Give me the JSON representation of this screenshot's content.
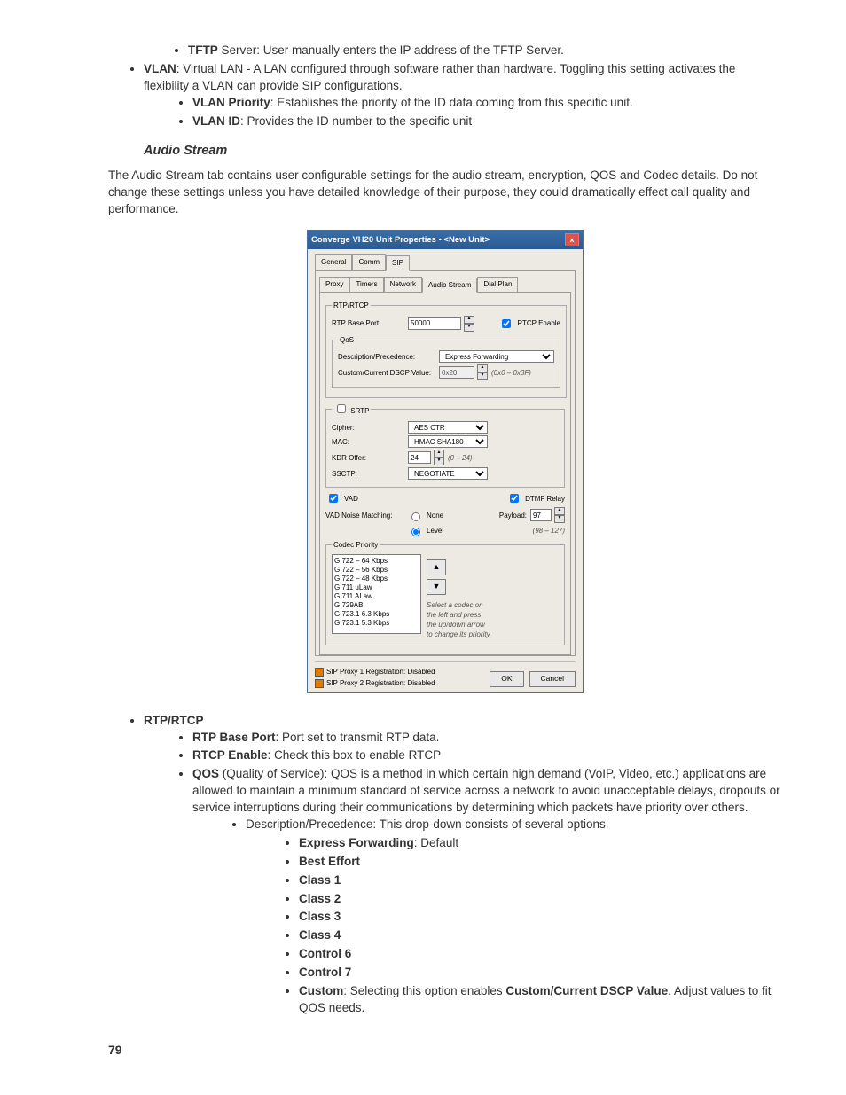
{
  "top_bullets": {
    "tftp": {
      "bold": "TFTP",
      "rest": " Server: User manually enters the IP address of the TFTP Server."
    },
    "vlan": {
      "bold": "VLAN",
      "rest": ": Virtual LAN - A LAN configured through software rather than hardware. Toggling this setting activates the flexibility a VLAN can provide SIP configurations."
    },
    "vlan_priority": {
      "bold": "VLAN Priority",
      "rest": ": Establishes the priority of the ID data coming from this specific unit."
    },
    "vlan_id": {
      "bold": "VLAN ID",
      "rest": ": Provides the ID number to the specific unit"
    }
  },
  "section_head": "Audio Stream",
  "intro_para": "The Audio Stream tab contains user configurable settings for the audio stream, encryption, QOS and Codec details. Do not change these settings unless you have detailed knowledge of their purpose, they could dramatically effect call quality and performance.",
  "dialog": {
    "title": "Converge VH20 Unit Properties - <New Unit>",
    "tabs_top": [
      "General",
      "Comm",
      "SIP"
    ],
    "tabs_top_sel": 2,
    "tabs_sub": [
      "Proxy",
      "Timers",
      "Network",
      "Audio Stream",
      "Dial Plan"
    ],
    "tabs_sub_sel": 3,
    "rtp": {
      "legend": "RTP/RTCP",
      "base_port_label": "RTP Base Port:",
      "base_port_value": "50000",
      "rtcp_enable_label": "RTCP Enable",
      "qos_legend": "QoS",
      "desc_label": "Description/Precedence:",
      "desc_value": "Express Forwarding",
      "dscp_label": "Custom/Current DSCP Value:",
      "dscp_value": "0x20",
      "dscp_hint": "(0x0 – 0x3F)"
    },
    "srtp": {
      "legend": "SRTP",
      "cipher_label": "Cipher:",
      "cipher_value": "AES CTR",
      "mac_label": "MAC:",
      "mac_value": "HMAC SHA180",
      "kdr_label": "KDR Offer:",
      "kdr_value": "24",
      "kdr_hint": "(0 – 24)",
      "ssctp_label": "SSCTP:",
      "ssctp_value": "NEGOTIATE"
    },
    "vad": {
      "vad_label": "VAD",
      "noise_label": "VAD Noise Matching:",
      "opt_none": "None",
      "opt_level": "Level",
      "dtmf_label": "DTMF Relay",
      "payload_label": "Payload:",
      "payload_value": "97",
      "payload_hint": "(98 – 127)"
    },
    "codec": {
      "legend": "Codec Priority",
      "items": [
        "G.722 – 64 Kbps",
        "G.722 – 56 Kbps",
        "G.722 – 48 Kbps",
        "G.711 uLaw",
        "G.711 ALaw",
        "G.729AB",
        "G.723.1 6.3 Kbps",
        "G.723.1 5.3 Kbps"
      ],
      "hint1": "Select a codec on",
      "hint2": "the left and press",
      "hint3": "the up/down arrow",
      "hint4": "to change its priority"
    },
    "status1": "SIP Proxy 1 Registration: Disabled",
    "status2": "SIP Proxy 2 Registration: Disabled",
    "ok": "OK",
    "cancel": "Cancel"
  },
  "lower": {
    "rtp_head": "RTP/RTCP",
    "rtp_base": {
      "bold": "RTP Base Port",
      "rest": ": Port set to transmit RTP data."
    },
    "rtcp_en": {
      "bold": "RTCP Enable",
      "rest": ": Check this box to enable RTCP"
    },
    "qos": {
      "bold": "QOS",
      "rest": " (Quality of Service): QOS is a method in which certain high demand (VoIP, Video, etc.) applications are allowed to maintain a minimum standard of service across a network to avoid unacceptable delays, dropouts or service interruptions during their communications by determining which packets have priority over others."
    },
    "desc_prec": "Description/Precedence: This drop-down consists of several options.",
    "express": {
      "bold": "Express Forwarding",
      "rest": ": Default"
    },
    "best_effort": "Best Effort",
    "c1": "Class 1",
    "c2": "Class 2",
    "c3": "Class 3",
    "c4": "Class 4",
    "ctrl6": "Control 6",
    "ctrl7": "Control 7",
    "custom": {
      "bold": "Custom",
      "rest1": ": Selecting this option enables ",
      "bold2": "Custom/Current DSCP Value",
      "rest2": ". Adjust values to fit QOS needs."
    }
  },
  "page_number": "79"
}
